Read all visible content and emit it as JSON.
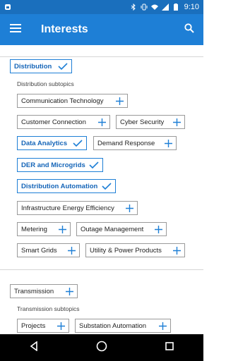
{
  "status_bar": {
    "time": "9:10",
    "icons": [
      "notification-icon",
      "bluetooth-icon",
      "vibrate-icon",
      "wifi-icon",
      "signal-icon",
      "battery-icon"
    ]
  },
  "app_bar": {
    "title": "Interests"
  },
  "sections": [
    {
      "name": "Distribution",
      "selected": true,
      "subtitle": "Distribution subtopics",
      "topics": [
        {
          "label": "Communication Technology",
          "selected": false
        },
        {
          "label": "Customer Connection",
          "selected": false
        },
        {
          "label": "Cyber Security",
          "selected": false
        },
        {
          "label": "Data Analytics",
          "selected": true
        },
        {
          "label": "Demand Response",
          "selected": false
        },
        {
          "label": "DER and Microgrids",
          "selected": true
        },
        {
          "label": "Distribution Automation",
          "selected": true
        },
        {
          "label": "Infrastructure Energy Efficiency",
          "selected": false
        },
        {
          "label": "Metering",
          "selected": false
        },
        {
          "label": "Outage Management",
          "selected": false
        },
        {
          "label": "Smart Grids",
          "selected": false
        },
        {
          "label": "Utility & Power Products",
          "selected": false
        }
      ]
    },
    {
      "name": "Transmission",
      "selected": false,
      "subtitle": "Transmission subtopics",
      "topics": [
        {
          "label": "Projects",
          "selected": false
        },
        {
          "label": "Substation Automation",
          "selected": false
        }
      ]
    }
  ],
  "colors": {
    "status_bar": "#1a6fbd",
    "app_bar": "#1e7fd6",
    "accent": "#1e7fd6",
    "nav_bar": "#000000"
  }
}
